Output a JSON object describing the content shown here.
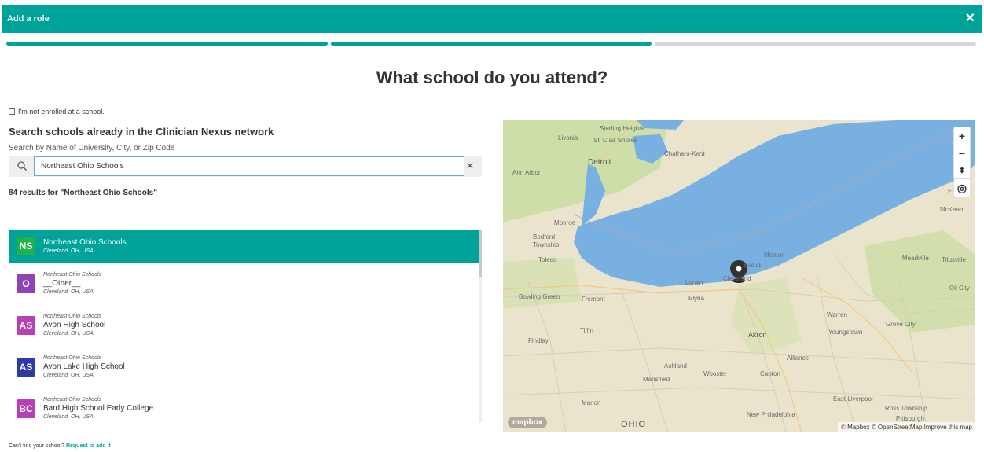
{
  "header": {
    "title": "Add a role",
    "close_glyph": "✕"
  },
  "progress": {
    "steps": 3,
    "completed": 2,
    "colors": {
      "done": "#00a39a",
      "todo": "#d3d6de"
    }
  },
  "page": {
    "heading": "What school do you attend?"
  },
  "not_enrolled": {
    "label": "I'm not enrolled at a school.",
    "checked": false
  },
  "search": {
    "title": "Search schools already in the Clinician Nexus network",
    "subtitle": "Search by Name of University, City, or Zip Code",
    "value": "Northeast Ohio Schools",
    "clear_glyph": "✕"
  },
  "results": {
    "count_text": "84 results for \"Northeast Ohio Schools\"",
    "items": [
      {
        "initials": "NS",
        "color": "#20b34a",
        "org": "",
        "name": "Northeast Ohio Schools",
        "location": "Cleveland, OH, USA",
        "selected": true
      },
      {
        "initials": "O",
        "color": "#8e44b8",
        "org": "Northeast Ohio Schools",
        "name": "__Other__",
        "location": "Cleveland, OH, USA",
        "selected": false
      },
      {
        "initials": "AS",
        "color": "#b93fb5",
        "org": "Northeast Ohio Schools",
        "name": "Avon High School",
        "location": "Cleveland, OH, USA",
        "selected": false
      },
      {
        "initials": "AS",
        "color": "#2d3aa8",
        "org": "Northeast Ohio Schools",
        "name": "Avon Lake High School",
        "location": "Cleveland, OH, USA",
        "selected": false
      },
      {
        "initials": "BC",
        "color": "#b93fb5",
        "org": "Northeast Ohio Schools",
        "name": "Bard High School Early College",
        "location": "Cleveland, OH, USA",
        "selected": false
      }
    ]
  },
  "footer": {
    "cant_find": "Can't find your school?",
    "request_link": "Request to add it"
  },
  "map": {
    "controls": {
      "zoom_in": "+",
      "zoom_out": "−",
      "compass": "⬍",
      "locate": "◎"
    },
    "logo": "mapbox",
    "attribution": "© Mapbox © OpenStreetMap Improve this map",
    "labels": {
      "sterling": "Sterling Heights",
      "stclair": "St. Clair Shores",
      "livonia": "Livonia",
      "detroit": "Detroit",
      "chatham": "Chatham-Kent",
      "annarbor": "Ann Arbor",
      "monroe": "Monroe",
      "bedford": "Bedford",
      "township": "Township",
      "toledo": "Toledo",
      "bowling": "Bowling Green",
      "fremont": "Fremont",
      "lorain": "Lorain",
      "elyria": "Elyria",
      "cleveland": "Cleveland",
      "euclid": "Euclid",
      "mentor": "Mentor",
      "erie": "Erie",
      "mckean": "McKean",
      "meadville": "Meadville",
      "titusville": "Titusville",
      "oilcity": "Oil City",
      "warren": "Warren",
      "grovecity": "Grove City",
      "youngstown": "Youngstown",
      "akron": "Akron",
      "alliance": "Alliance",
      "tiffin": "Tiffin",
      "findlay": "Findlay",
      "ashland": "Ashland",
      "wooster": "Wooster",
      "canton": "Canton",
      "mansfield": "Mansfield",
      "marion": "Marion",
      "newphil": "New Philadelphia",
      "eastliverpool": "East Liverpool",
      "ross": "Ross Township",
      "pittsburgh": "Pittsburgh",
      "ohio": "OHIO"
    }
  }
}
